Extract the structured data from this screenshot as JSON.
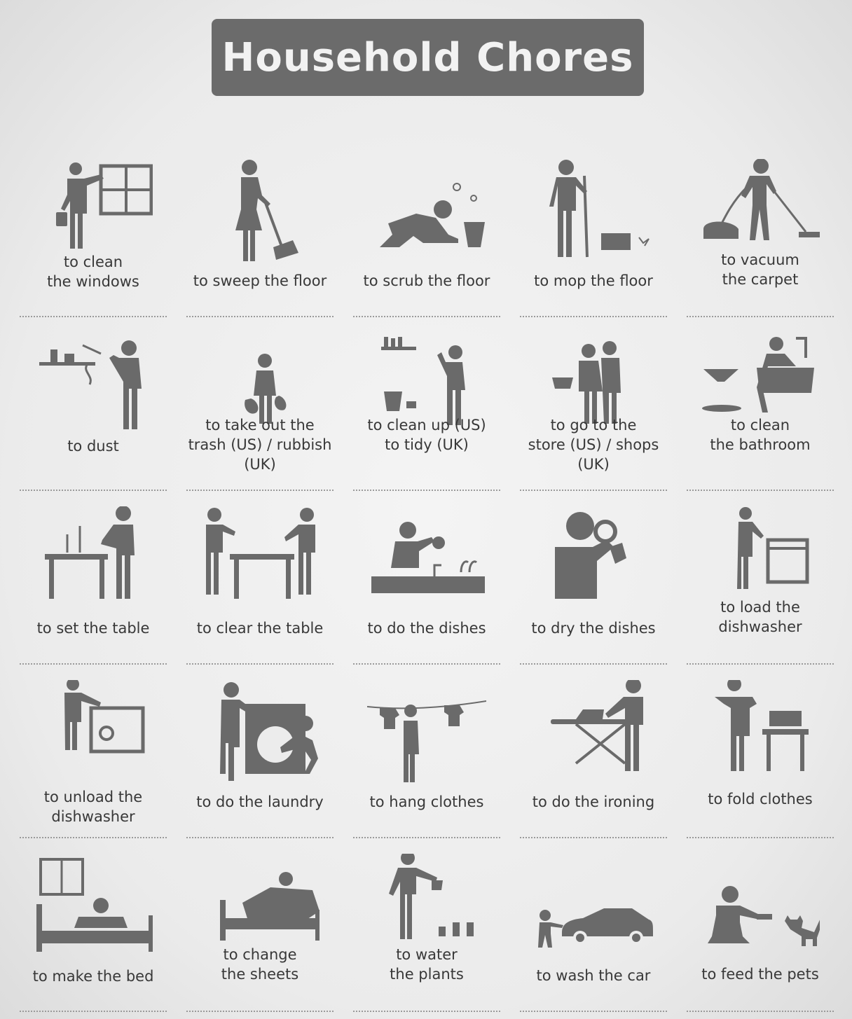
{
  "title": "Household Chores",
  "colors": {
    "icon": "#6a6a6a",
    "title_bg": "#6b6b6b",
    "title_text": "#f2f2f2",
    "background": "#ededed"
  },
  "chores": [
    {
      "label": "to clean\nthe windows",
      "icon": "window-cleaning-icon"
    },
    {
      "label": "to sweep the floor",
      "icon": "broom-icon"
    },
    {
      "label": "to scrub the floor",
      "icon": "scrub-brush-icon"
    },
    {
      "label": "to mop the floor",
      "icon": "mop-icon"
    },
    {
      "label": "to vacuum\nthe carpet",
      "icon": "vacuum-icon"
    },
    {
      "label": "to dust",
      "icon": "duster-icon"
    },
    {
      "label": "to take out the\ntrash (US) / rubbish (UK)",
      "icon": "trash-bag-icon"
    },
    {
      "label": "to clean up (US)\nto tidy (UK)",
      "icon": "tidy-shelf-icon"
    },
    {
      "label": "to go to the\nstore (US) / shops (UK)",
      "icon": "shopping-basket-icon"
    },
    {
      "label": "to clean\nthe bathroom",
      "icon": "bathtub-icon"
    },
    {
      "label": "to set the table",
      "icon": "set-table-icon"
    },
    {
      "label": "to clear the table",
      "icon": "clear-table-icon"
    },
    {
      "label": "to do the dishes",
      "icon": "sink-icon"
    },
    {
      "label": "to dry the dishes",
      "icon": "dish-towel-icon"
    },
    {
      "label": "to load the\ndishwasher",
      "icon": "dishwasher-load-icon"
    },
    {
      "label": "to unload the\ndishwasher",
      "icon": "dishwasher-unload-icon"
    },
    {
      "label": "to do the laundry",
      "icon": "washing-machine-icon"
    },
    {
      "label": "to hang clothes",
      "icon": "clothesline-icon"
    },
    {
      "label": "to do the ironing",
      "icon": "iron-icon"
    },
    {
      "label": "to fold clothes",
      "icon": "folded-clothes-icon"
    },
    {
      "label": "to make the bed",
      "icon": "bed-icon"
    },
    {
      "label": "to change\nthe sheets",
      "icon": "sheets-icon"
    },
    {
      "label": "to water\nthe plants",
      "icon": "watering-can-icon"
    },
    {
      "label": "to wash the car",
      "icon": "car-icon"
    },
    {
      "label": "to feed the pets",
      "icon": "cat-icon"
    }
  ]
}
